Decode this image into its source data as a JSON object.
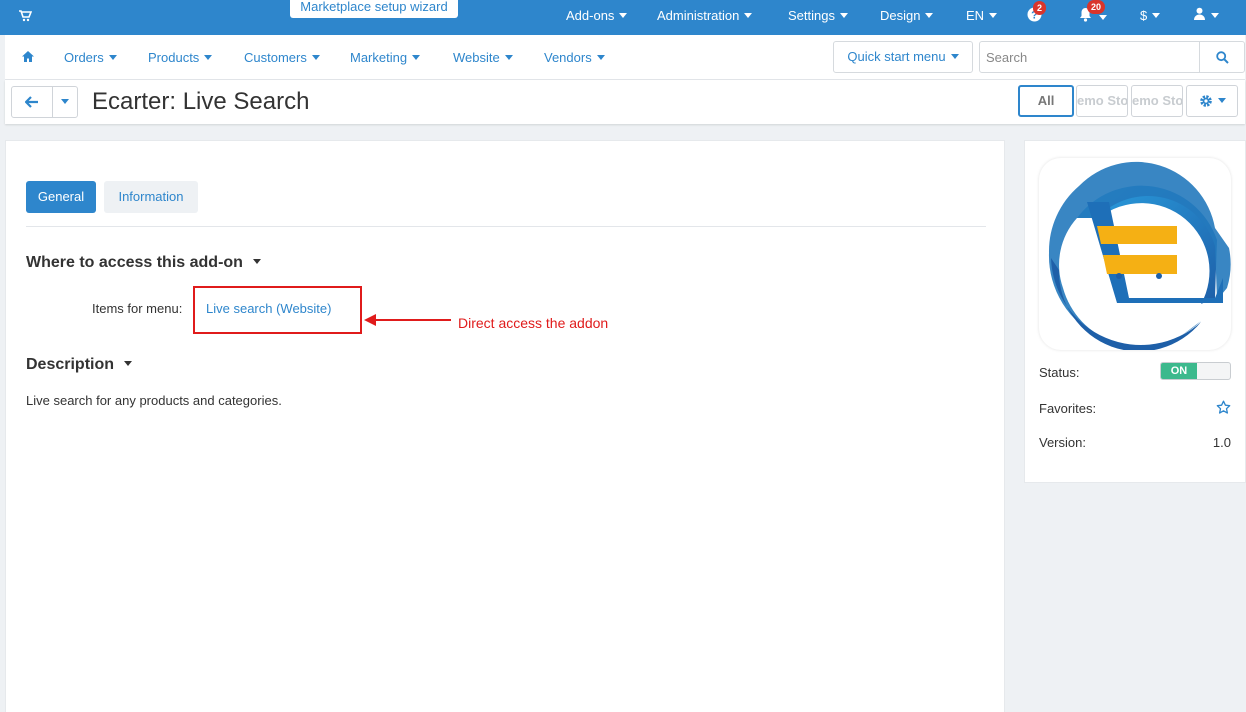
{
  "topbar": {
    "wizard_label": "Marketplace setup wizard",
    "menu": [
      "Add-ons",
      "Administration",
      "Settings",
      "Design",
      "EN"
    ],
    "help_badge": "2",
    "notifications_badge": "20",
    "currency": "$"
  },
  "navbar": {
    "items": [
      "Orders",
      "Products",
      "Customers",
      "Marketing",
      "Website",
      "Vendors"
    ],
    "quick_start_label": "Quick start menu",
    "search_placeholder": "Search"
  },
  "titlebar": {
    "title": "Ecarter: Live Search",
    "stores": [
      "All",
      "emo Sto",
      "emo Sto"
    ]
  },
  "main": {
    "tabs": [
      "General",
      "Information"
    ],
    "where_heading": "Where to access this add-on",
    "items_label": "Items for menu:",
    "items_link": "Live search (Website)",
    "annotation": "Direct access the addon",
    "description_heading": "Description",
    "description_text": "Live search for any products and categories."
  },
  "sidebar": {
    "status_label": "Status:",
    "status_value": "ON",
    "favorites_label": "Favorites:",
    "version_label": "Version:",
    "version_value": "1.0"
  },
  "colors": {
    "primary": "#2e86cc",
    "annotation_red": "#e01b1b",
    "status_on": "#3cb98d",
    "badge_red": "#d9352c"
  }
}
